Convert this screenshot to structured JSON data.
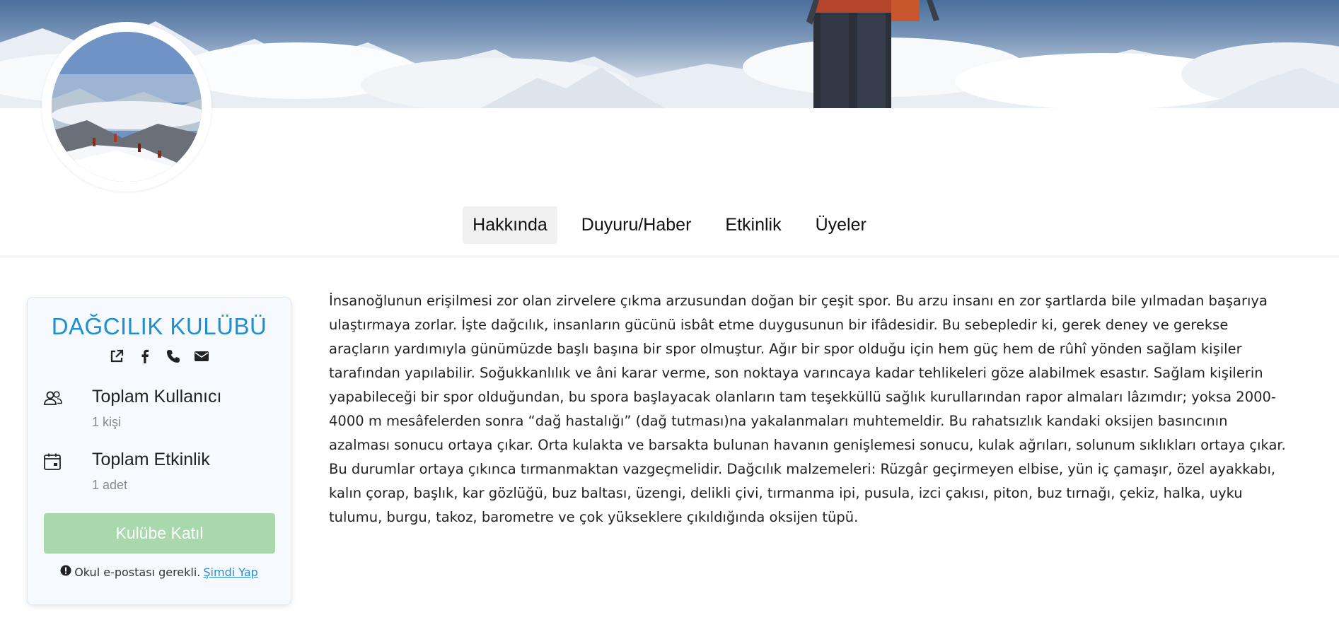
{
  "tabs": [
    {
      "label": "Hakkında",
      "active": true
    },
    {
      "label": "Duyuru/Haber",
      "active": false
    },
    {
      "label": "Etkinlik",
      "active": false
    },
    {
      "label": "Üyeler",
      "active": false
    }
  ],
  "club": {
    "name": "DAĞCILIK KULÜBÜ",
    "contact_icons": [
      "external-link-icon",
      "facebook-icon",
      "phone-icon",
      "envelope-icon"
    ],
    "stats": [
      {
        "icon": "users-icon",
        "title": "Toplam Kullanıcı",
        "value": "1 kişi"
      },
      {
        "icon": "calendar-icon",
        "title": "Toplam Etkinlik",
        "value": "1 adet"
      }
    ],
    "join_button": "Kulübe Katıl",
    "notice_text": "Okul e-postası gerekli.",
    "notice_link": "Şimdi Yap"
  },
  "about_text": "İnsanoğlunun erişilmesi zor olan zirvelere çıkma arzusundan doğan bir çeşit spor. Bu arzu insanı en zor şartlarda bile yılmadan başarıya ulaştırmaya zorlar. İşte dağcılık, insanların gücünü isbât etme duygusunun bir ifâdesidir. Bu sebepledir ki, gerek deney ve gerekse araçların yardımıyla günümüzde başlı başına bir spor olmuştur. Ağır bir spor olduğu için hem güç hem de rûhî yönden sağlam kişiler tarafından yapılabilir. Soğukkanlılık ve âni karar verme, son noktaya varıncaya kadar tehlikeleri göze alabilmek esastır. Sağlam kişilerin yapabileceği bir spor olduğundan, bu spora başlayacak olanların tam teşekküllü sağlık kurullarından rapor almaları lâzımdır; yoksa 2000-4000 m mesâfelerden sonra “dağ hastalığı” (dağ tutması)na yakalanmaları muhtemeldir. Bu rahatsızlık kandaki oksijen basıncının azalması sonucu ortaya çıkar. Orta kulakta ve barsakta bulunan havanın genişlemesi sonucu, kulak ağrıları, solunum sıklıkları ortaya çıkar. Bu durumlar ortaya çıkınca tırmanmaktan vazgeçmelidir. Dağcılık malzemeleri: Rüzgâr geçirmeyen elbise, yün iç çamaşır, özel ayakkabı, kalın çorap, başlık, kar gözlüğü, buz baltası, üzengi, delikli çivi, tırmanma ipi, pusula, izci çakısı, piton, buz tırnağı, çekiz, halka, uyku tulumu, burgu, takoz, barometre ve çok yükseklere çıkıldığında oksijen tüpü.",
  "colors": {
    "club_name": "#1f8fd0",
    "join_button_bg": "#a9d8ad",
    "link": "#2a8dd0"
  }
}
